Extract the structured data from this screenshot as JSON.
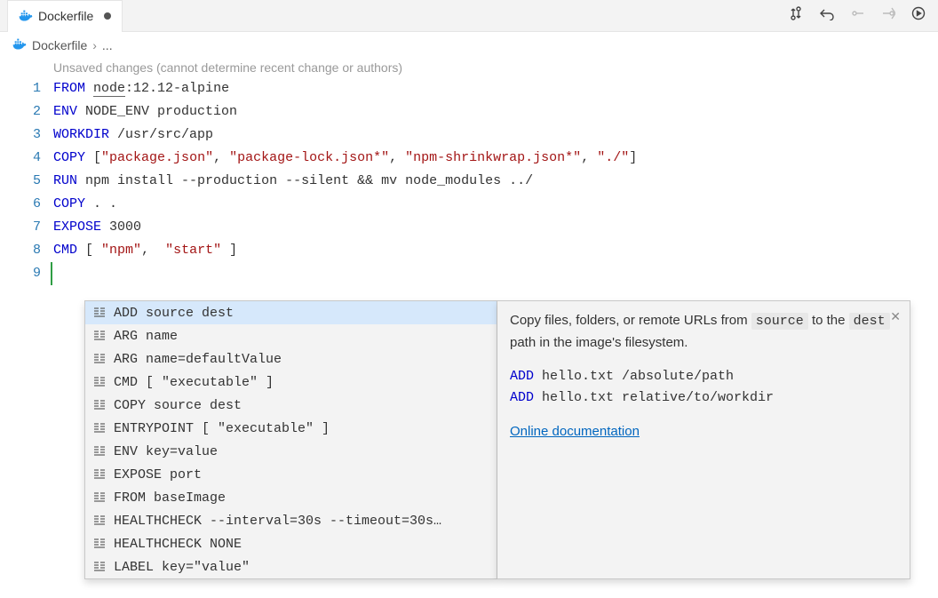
{
  "tab": {
    "filename": "Dockerfile"
  },
  "breadcrumb": {
    "filename": "Dockerfile",
    "separator": "›",
    "ellipsis": "..."
  },
  "gitlens": "Unsaved changes (cannot determine recent change or authors)",
  "lines": [
    "1",
    "2",
    "3",
    "4",
    "5",
    "6",
    "7",
    "8",
    "9"
  ],
  "code": {
    "l1": {
      "kw": "FROM",
      "img": "node",
      "tag": ":12.12-alpine"
    },
    "l2": {
      "kw": "ENV",
      "rest": "NODE_ENV production"
    },
    "l3": {
      "kw": "WORKDIR",
      "rest": "/usr/src/app"
    },
    "l4": {
      "kw": "COPY",
      "b1": "[",
      "s1": "\"package.json\"",
      "c": ", ",
      "s2": "\"package-lock.json*\"",
      "s3": "\"npm-shrinkwrap.json*\"",
      "s4": "\"./\"",
      "b2": "]"
    },
    "l5": {
      "kw": "RUN",
      "rest": "npm install --production --silent && mv node_modules ../"
    },
    "l6": {
      "kw": "COPY",
      "rest": ". ."
    },
    "l7": {
      "kw": "EXPOSE",
      "rest": "3000"
    },
    "l8": {
      "kw": "CMD",
      "b1": "[ ",
      "s1": "\"npm\"",
      "c": ",  ",
      "s2": "\"start\"",
      "b2": " ]"
    }
  },
  "suggest": {
    "items": [
      "ADD source dest",
      "ARG name",
      "ARG name=defaultValue",
      "CMD [ \"executable\" ]",
      "COPY source dest",
      "ENTRYPOINT [ \"executable\" ]",
      "ENV key=value",
      "EXPOSE port",
      "FROM baseImage",
      "HEALTHCHECK --interval=30s --timeout=30s…",
      "HEALTHCHECK NONE",
      "LABEL key=\"value\""
    ],
    "selectedIndex": 0
  },
  "doc": {
    "text1": "Copy files, folders, or remote URLs from ",
    "chip1": "source",
    "text2": " to the ",
    "chip2": "dest",
    "text3": " path in the image's filesystem.",
    "ex1kw": "ADD",
    "ex1rest": " hello.txt /absolute/path",
    "ex2kw": "ADD",
    "ex2rest": " hello.txt relative/to/workdir",
    "link": "Online documentation"
  }
}
